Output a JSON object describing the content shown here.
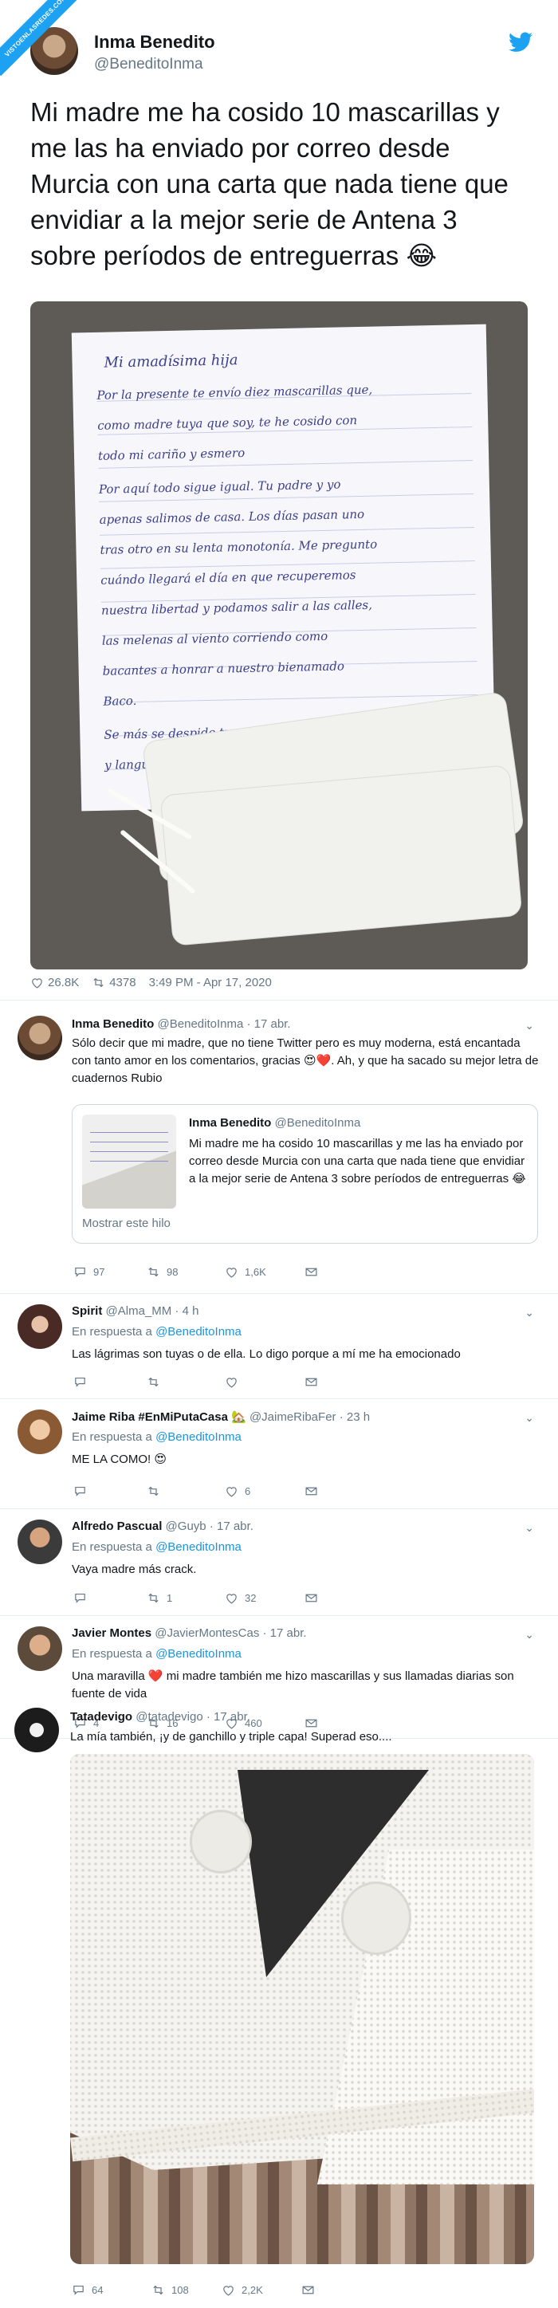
{
  "watermark": "VISTOENLASREDES.COM",
  "main_tweet": {
    "name": "Inma Benedito",
    "handle": "@BeneditoInma",
    "text": "Mi madre me ha cosido 10 mascarillas y me las ha enviado por correo desde Murcia con una carta que nada tiene que envidiar a la mejor serie de Antena 3 sobre períodos de entreguerras 😂",
    "likes": "26.8K",
    "retweets": "4378",
    "timestamp": "3:49 PM - Apr 17, 2020",
    "letter_lines": [
      "Mi amadísima hija",
      "Por la presente te envío diez mascarillas que,",
      "como madre tuya que soy, te he cosido con",
      "todo mi cariño y esmero",
      "Por aquí todo sigue igual. Tu padre y yo",
      "apenas salimos de casa. Los días pasan uno",
      "tras otro en su lenta monotonía. Me pregunto",
      "cuándo llegará el día en que recuperemos",
      "nuestra libertad y podamos salir a las calles,",
      "las melenas al viento corriendo como",
      "bacantes a honrar a nuestro bienamado",
      "Baco.",
      "Se más se despide tu madre que te quiere",
      "y languidece en su anhelo de volverte a ver."
    ]
  },
  "replies": [
    {
      "name": "Inma Benedito",
      "handle": "@BeneditoInma",
      "time": "17 abr.",
      "text": "Sólo decir que mi madre, que no tiene Twitter pero es muy moderna, está encantada con tanto amor en los comentarios, gracias 😍❤️. Ah, y que ha sacado su mejor letra de cuadernos Rubio",
      "quote": {
        "name": "Inma Benedito",
        "handle": "@BeneditoInma",
        "text": "Mi madre me ha cosido 10 mascarillas y me las ha enviado por correo desde Murcia con una carta que nada tiene que envidiar a la mejor serie de Antena 3 sobre períodos de entreguerras 😂",
        "show_thread": "Mostrar este hilo"
      },
      "replies": "97",
      "retweets": "98",
      "likes": "1,6K"
    },
    {
      "name": "Spirit",
      "handle": "@Alma_MM",
      "time": "4 h",
      "in_reply_prefix": "En respuesta a",
      "in_reply_to": "@BeneditoInma",
      "text": "Las lágrimas son tuyas o de ella. Lo digo porque a mí me ha emocionado",
      "replies": "",
      "retweets": "",
      "likes": ""
    },
    {
      "name": "Jaime Riba #EnMiPutaCasa 🏡",
      "handle": "@JaimeRibaFer",
      "time": "23 h",
      "in_reply_prefix": "En respuesta a",
      "in_reply_to": "@BeneditoInma",
      "text": "ME LA COMO! 😍",
      "replies": "",
      "retweets": "",
      "likes": "6"
    },
    {
      "name": "Alfredo Pascual",
      "handle": "@Guyb",
      "time": "17 abr.",
      "in_reply_prefix": "En respuesta a",
      "in_reply_to": "@BeneditoInma",
      "text": "Vaya madre más crack.",
      "replies": "",
      "retweets": "1",
      "likes": "32"
    },
    {
      "name": "Javier Montes",
      "handle": "@JavierMontesCas",
      "time": "17 abr.",
      "in_reply_prefix": "En respuesta a",
      "in_reply_to": "@BeneditoInma",
      "text": "Una maravilla ❤️ mi madre también me hizo mascarillas y sus llamadas diarias son fuente de vida",
      "replies": "4",
      "retweets": "16",
      "likes": "460"
    },
    {
      "name": "Tatadevigo",
      "handle": "@tatadevigo",
      "time": "17 abr.",
      "text": "La mía también, ¡y de ganchillo y triple capa! Superad eso....",
      "replies": "64",
      "retweets": "108",
      "likes": "2,2K"
    }
  ]
}
